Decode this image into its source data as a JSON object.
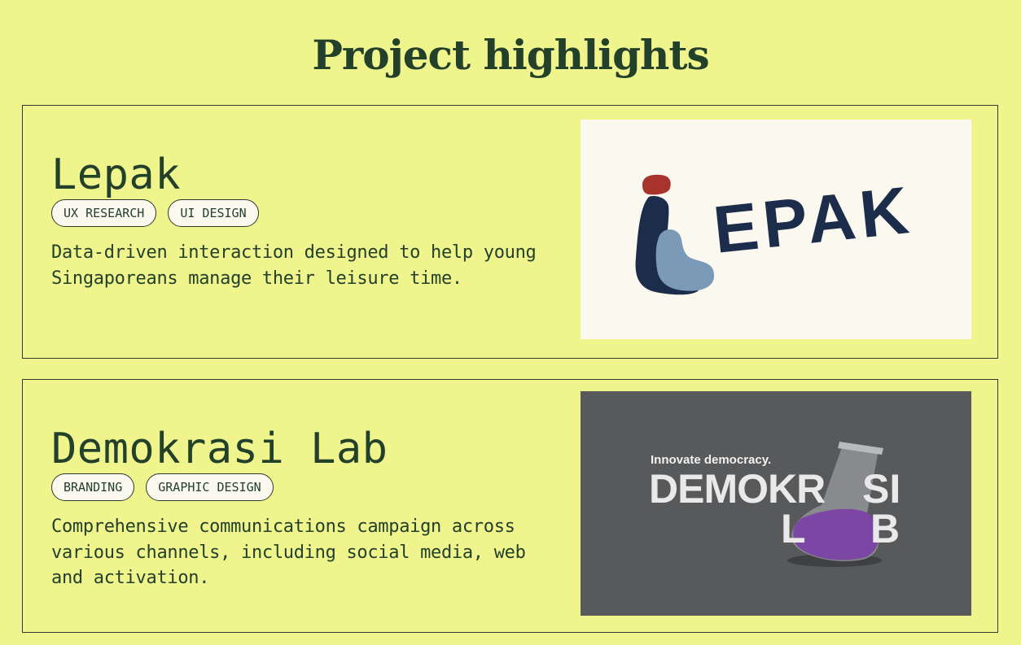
{
  "page": {
    "title": "Project highlights"
  },
  "projects": [
    {
      "title": "Lepak",
      "tags": [
        "UX RESEARCH",
        "UI DESIGN"
      ],
      "description": "Data-driven interaction designed to help young Singaporeans manage their leisure time.",
      "image": {
        "logo_text": "EPAK",
        "background": "#fbf8f0",
        "logo_color": "#1b2d4a",
        "accent_red": "#a8322c",
        "accent_blue": "#7b9ab8"
      }
    },
    {
      "title": "Demokrasi Lab",
      "tags": [
        "BRANDING",
        "GRAPHIC DESIGN"
      ],
      "description": "Comprehensive communications campaign across various channels, including social media, web and activation.",
      "image": {
        "tagline": "Innovate democracy.",
        "logo_line1": "DEMOKR",
        "logo_line1_end": "SI",
        "logo_line2_start": "L",
        "logo_line2_end": "B",
        "background": "#58595b",
        "text_color": "#f2f2f2",
        "flask_color": "#7b3fa6"
      }
    }
  ],
  "colors": {
    "page_background": "#f0f48d",
    "text": "#23402a",
    "border": "#2a3a2c",
    "tag_background": "#fbf8ee"
  }
}
